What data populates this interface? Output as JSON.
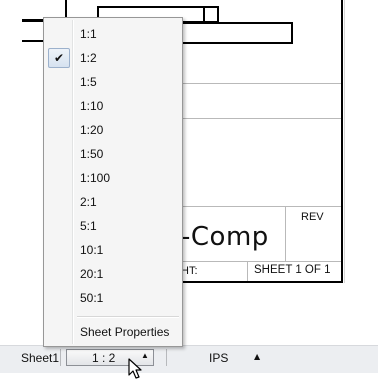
{
  "drawing": {
    "title_fragment": "-Comp",
    "rev_label": "REV",
    "weight_fragment": "HT:",
    "sheet_of": "SHEET 1 OF 1"
  },
  "scale_menu": {
    "selected": "1:2",
    "options": [
      "1:1",
      "1:2",
      "1:5",
      "1:10",
      "1:20",
      "1:50",
      "1:100",
      "2:1",
      "5:1",
      "10:1",
      "20:1",
      "50:1"
    ],
    "sheet_properties_label": "Sheet Properties"
  },
  "status_bar": {
    "sheet_tab": "Sheet1",
    "scale_value": "1 : 2",
    "scale_arrow": "▲",
    "units": "IPS",
    "units_arrow": "▲"
  },
  "icons": {
    "check": "checkmark-icon",
    "cursor": "mouse-pointer-icon"
  }
}
